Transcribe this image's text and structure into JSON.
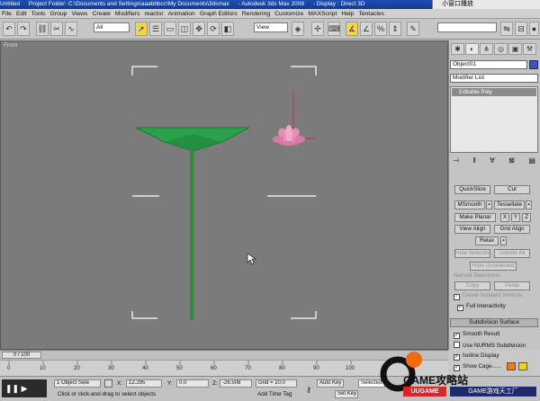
{
  "window": {
    "title": "Untitled",
    "project": "Project Folder: C:\\Documents and Settings\\aaabbbcc\\My Documents\\3dsmax",
    "app": "- Autodesk 3ds Max 2008",
    "display": "- Display : Direct 3D",
    "caption": "小窗口播放"
  },
  "menu": [
    "File",
    "Edit",
    "Tools",
    "Group",
    "Views",
    "Create",
    "Modifiers",
    "reactor",
    "Animation",
    "Graph Editors",
    "Rendering",
    "Customize",
    "MAXScript",
    "Help",
    "Tentacles"
  ],
  "toolbar": {
    "selection_filter": "All",
    "reference_coord": "View"
  },
  "viewport": {
    "label": "Front"
  },
  "cmdpanel": {
    "object_name": "Object01",
    "modifier_list": "Modifier List",
    "stack_item": "Editable Poly",
    "buttons": {
      "quickslice": "QuickSlice",
      "cut": "Cut",
      "msmooth": "MSmooth",
      "tessellate": "Tessellate",
      "make_planar": "Make Planar",
      "x": "X",
      "y": "Y",
      "z": "Z",
      "view_align": "View Align",
      "grid_align": "Grid Align",
      "relax": "Relax",
      "hide_selected": "Hide Selected",
      "unhide_all": "Unhide All",
      "hide_unselected": "Hide Unselected",
      "named_selections": "Named Selections:",
      "copy": "Copy",
      "paste": "Paste"
    },
    "delete_isolated": "Delete Isolated Vertices",
    "full_interactivity": "Full Interactivity",
    "rollout_subdivision": "Subdivision Surface",
    "smooth_result": "Smooth Result",
    "use_nurms": "Use NURMS Subdivision",
    "isoline": "Isoline Display",
    "show_cage": "Show Cage......"
  },
  "timeline": {
    "frame": "0 / 100",
    "ticks": [
      "0",
      "10",
      "20",
      "30",
      "40",
      "50",
      "60",
      "70",
      "80",
      "90",
      "100"
    ]
  },
  "status": {
    "selection": "1 Object Sele",
    "x_label": "X:",
    "x_value": "12.295",
    "y_label": "Y:",
    "y_value": "0.0",
    "z_label": "Z:",
    "z_value": "-26.508",
    "grid": "Grid = 10.0",
    "auto_key": "Auto Key",
    "selected": "Selected",
    "set_key": "Set Key",
    "prompt": "Click or click-and-drag to select objects",
    "add_time_tag": "Add Time Tag"
  },
  "watermark": {
    "brand": "GAME攻略站",
    "sub": "GAME游戏天工厂",
    "badge": "UUGAME"
  },
  "colors": {
    "stem": "#2f8a3a",
    "leaf": "#2aa04a",
    "flower": "#e58fb4",
    "viewport_bg": "#7b7b7b",
    "title_blue": "#1f4fb5"
  }
}
